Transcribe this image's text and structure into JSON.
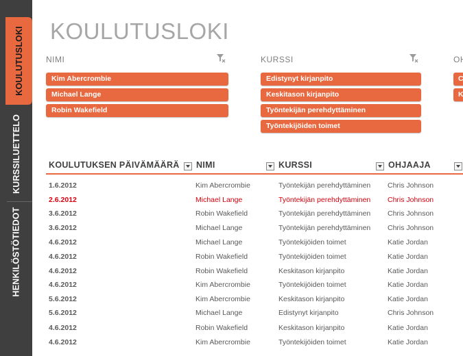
{
  "sidebar": {
    "tabs": [
      {
        "label": "KOULUTUSLOKI",
        "active": true
      },
      {
        "label": "KURSSILUETTELO",
        "active": false
      },
      {
        "label": "HENKILÖSTÖTIEDOT",
        "active": false
      }
    ]
  },
  "title": "KOULUTUSLOKI",
  "slicers": [
    {
      "header": "NIMI",
      "items": [
        "Kim Abercrombie",
        "Michael Lange",
        "Robin Wakefield"
      ]
    },
    {
      "header": "KURSSI",
      "items": [
        "Edistynyt kirjanpito",
        "Keskitason kirjanpito",
        "Työntekijän perehdyttäminen",
        "Työntekijöiden toimet"
      ]
    },
    {
      "header": "OH",
      "items": [
        "C",
        "K"
      ]
    }
  ],
  "table": {
    "columns": [
      "KOULUTUKSEN PÄIVÄMÄÄRÄ",
      "NIMI",
      "KURSSI",
      "OHJAAJA"
    ],
    "rows": [
      {
        "date": "1.6.2012",
        "name": "Kim Abercrombie",
        "course": "Työntekijän perehdyttäminen",
        "instructor": "Chris Johnson",
        "highlight": false
      },
      {
        "date": "2.6.2012",
        "name": "Michael Lange",
        "course": "Työntekijän perehdyttäminen",
        "instructor": "Chris Johnson",
        "highlight": true
      },
      {
        "date": "3.6.2012",
        "name": "Robin Wakefield",
        "course": "Työntekijän perehdyttäminen",
        "instructor": "Chris Johnson",
        "highlight": false
      },
      {
        "date": "3.6.2012",
        "name": "Michael Lange",
        "course": "Työntekijän perehdyttäminen",
        "instructor": "Chris Johnson",
        "highlight": false
      },
      {
        "date": "4.6.2012",
        "name": "Michael Lange",
        "course": "Työntekijöiden toimet",
        "instructor": "Katie Jordan",
        "highlight": false
      },
      {
        "date": "4.6.2012",
        "name": "Robin Wakefield",
        "course": "Työntekijöiden toimet",
        "instructor": "Katie Jordan",
        "highlight": false
      },
      {
        "date": "4.6.2012",
        "name": "Robin Wakefield",
        "course": "Keskitason kirjanpito",
        "instructor": "Katie Jordan",
        "highlight": false
      },
      {
        "date": "4.6.2012",
        "name": "Kim Abercrombie",
        "course": "Työntekijöiden toimet",
        "instructor": "Katie Jordan",
        "highlight": false
      },
      {
        "date": "5.6.2012",
        "name": "Kim Abercrombie",
        "course": "Keskitason kirjanpito",
        "instructor": "Katie Jordan",
        "highlight": false
      },
      {
        "date": "5.6.2012",
        "name": "Michael Lange",
        "course": "Edistynyt kirjanpito",
        "instructor": "Chris Johnson",
        "highlight": false
      },
      {
        "date": "4.6.2012",
        "name": "Robin Wakefield",
        "course": "Keskitason kirjanpito",
        "instructor": "Katie Jordan",
        "highlight": false
      },
      {
        "date": "4.6.2012",
        "name": "Kim Abercrombie",
        "course": "Työntekijöiden toimet",
        "instructor": "Katie Jordan",
        "highlight": false
      }
    ]
  },
  "colors": {
    "accent": "#e8683f",
    "sidebar": "#3f3f3f",
    "highlight": "#d8000c"
  }
}
